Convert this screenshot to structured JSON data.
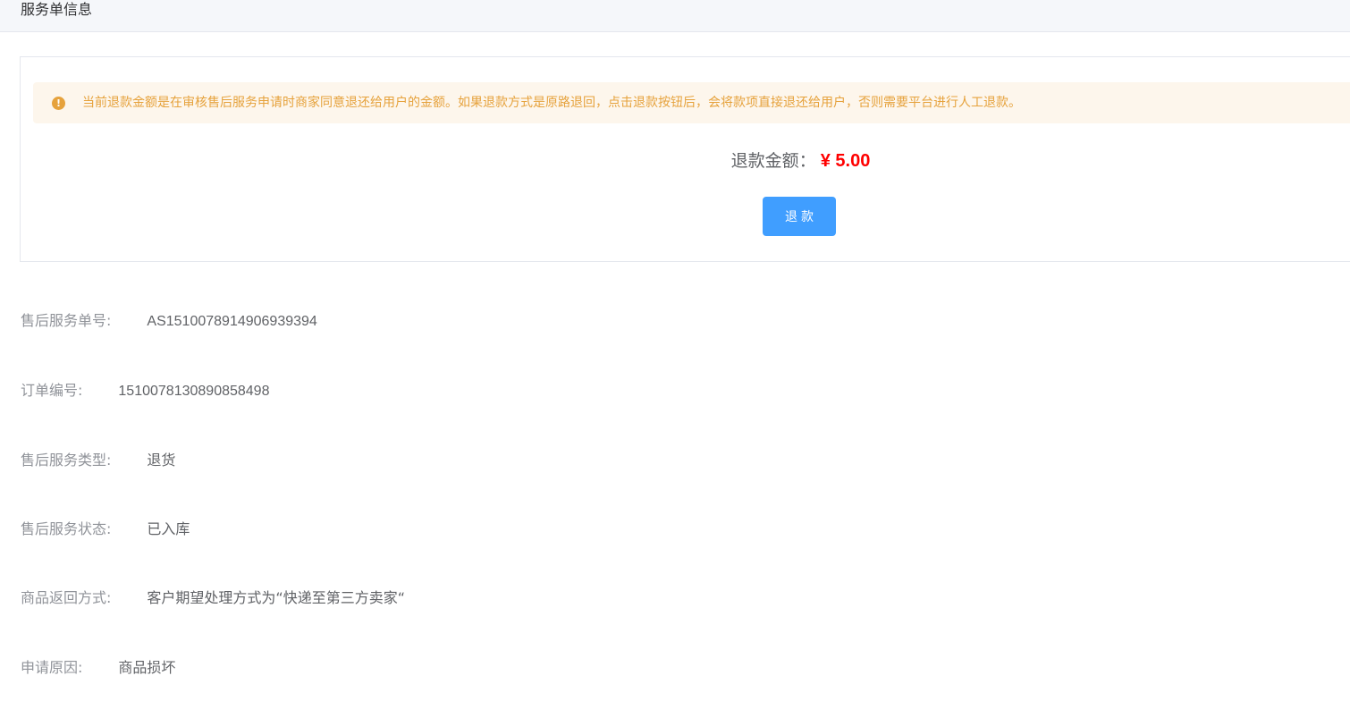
{
  "header": {
    "title": "服务单信息"
  },
  "refund_panel": {
    "alert_icon": "!",
    "alert_text": "当前退款金额是在审核售后服务申请时商家同意退还给用户的金额。如果退款方式是原路退回，点击退款按钮后，会将款项直接退还给用户，否则需要平台进行人工退款。",
    "amount_label": "退款金额：",
    "amount_value": "¥ 5.00",
    "refund_button_label": "退款"
  },
  "details": [
    {
      "label": "售后服务单号:",
      "value": "AS1510078914906939394"
    },
    {
      "label": "订单编号:",
      "value": "1510078130890858498"
    },
    {
      "label": "售后服务类型:",
      "value": "退货"
    },
    {
      "label": "售后服务状态:",
      "value": "已入库"
    },
    {
      "label": "商品返回方式:",
      "value": "客户期望处理方式为“快递至第三方卖家“"
    },
    {
      "label": "申请原因:",
      "value": "商品损坏"
    }
  ],
  "colors": {
    "accent": "#409eff",
    "warning": "#e6a23c",
    "amount": "#ff0000"
  }
}
